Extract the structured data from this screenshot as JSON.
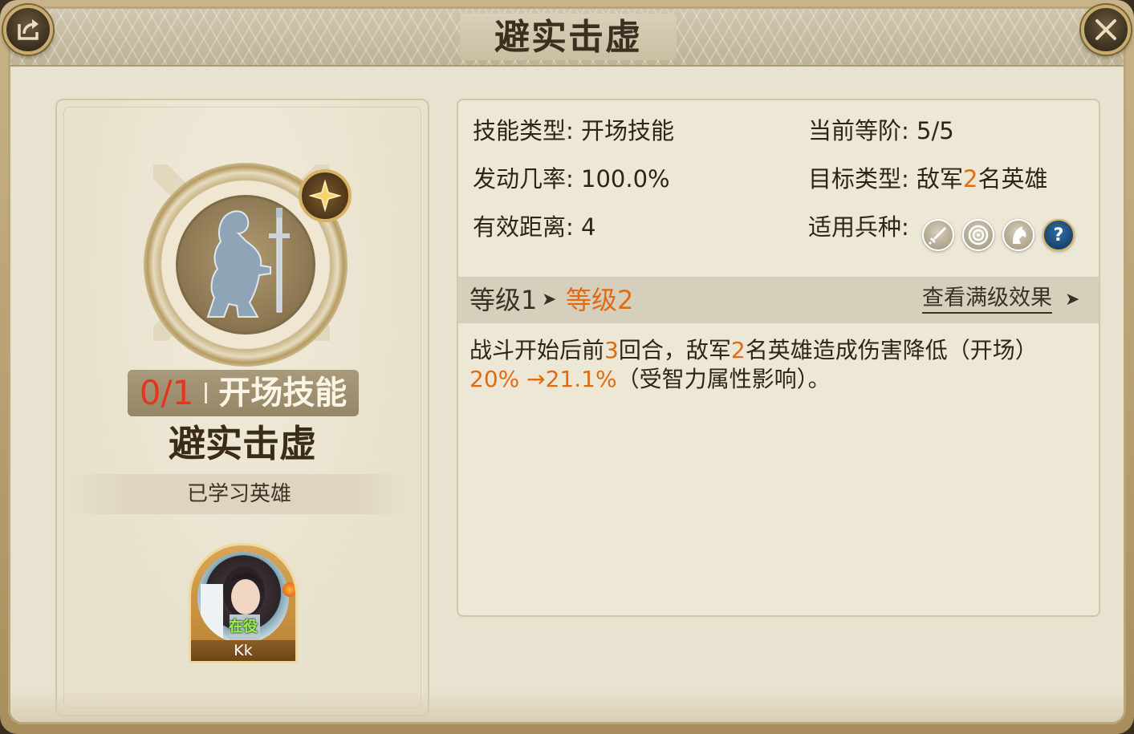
{
  "title": "避实击虚",
  "icons": {
    "share": "share-icon",
    "close": "close-icon"
  },
  "skill": {
    "count": "0/1",
    "type_tag": "开场技能",
    "name": "避实击虚",
    "learned_label": "已学习英雄",
    "star_icon": "star-badge-icon"
  },
  "hero": {
    "status": "在役",
    "name": "Kk"
  },
  "info": {
    "skill_type_label": "技能类型:",
    "skill_type_value": "开场技能",
    "rank_label": "当前等阶:",
    "rank_value": "5/5",
    "chance_label": "发动几率:",
    "chance_value": "100.0%",
    "target_label": "目标类型:",
    "target_prefix": "敌军",
    "target_count": "2",
    "target_suffix": "名英雄",
    "range_label": "有效距离:",
    "range_value": "4",
    "troop_label": "适用兵种:",
    "troops": [
      "sword-icon",
      "target-icon",
      "horse-icon",
      "question-icon"
    ]
  },
  "level": {
    "current": "等级1",
    "next": "等级2",
    "full_link": "查看满级效果"
  },
  "description": {
    "p1": "战斗开始后前",
    "n1": "3",
    "p2": "回合，敌军",
    "n2": "2",
    "p3": "名英雄造成伤害降低（开场）",
    "from": "20%",
    "arrow": " →",
    "to": "21.1%",
    "p4": "（受智力属性影响）。"
  },
  "colors": {
    "highlight": "#e06b12",
    "count_red": "#e8331f"
  }
}
